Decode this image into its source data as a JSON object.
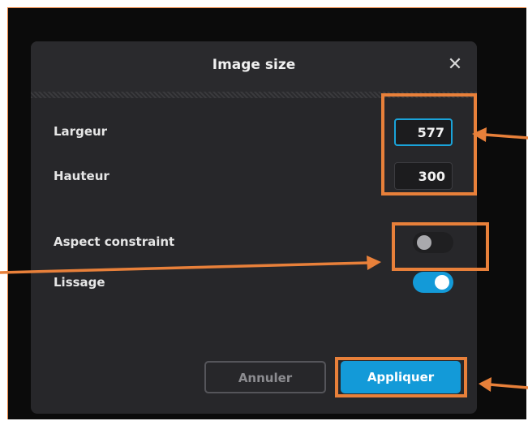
{
  "dialog": {
    "title": "Image size",
    "close_glyph": "✕",
    "fields": {
      "width_label": "Largeur",
      "width_value": "577",
      "height_label": "Hauteur",
      "height_value": "300"
    },
    "options": {
      "aspect_label": "Aspect constraint",
      "aspect_on": false,
      "smooth_label": "Lissage",
      "smooth_on": true
    },
    "buttons": {
      "cancel": "Annuler",
      "apply": "Appliquer"
    }
  },
  "colors": {
    "accent": "#139ad8",
    "highlight": "#e8803a",
    "dialog_bg": "#27272a"
  }
}
